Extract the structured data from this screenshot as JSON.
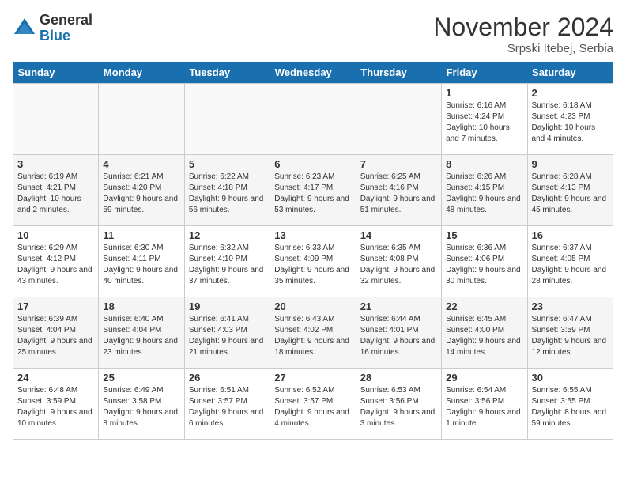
{
  "logo": {
    "general": "General",
    "blue": "Blue"
  },
  "header": {
    "month": "November 2024",
    "location": "Srpski Itebej, Serbia"
  },
  "days_of_week": [
    "Sunday",
    "Monday",
    "Tuesday",
    "Wednesday",
    "Thursday",
    "Friday",
    "Saturday"
  ],
  "weeks": [
    [
      {
        "day": "",
        "empty": true
      },
      {
        "day": "",
        "empty": true
      },
      {
        "day": "",
        "empty": true
      },
      {
        "day": "",
        "empty": true
      },
      {
        "day": "",
        "empty": true
      },
      {
        "day": "1",
        "sunrise": "6:16 AM",
        "sunset": "4:24 PM",
        "daylight": "10 hours and 7 minutes."
      },
      {
        "day": "2",
        "sunrise": "6:18 AM",
        "sunset": "4:23 PM",
        "daylight": "10 hours and 4 minutes."
      }
    ],
    [
      {
        "day": "3",
        "sunrise": "6:19 AM",
        "sunset": "4:21 PM",
        "daylight": "10 hours and 2 minutes."
      },
      {
        "day": "4",
        "sunrise": "6:21 AM",
        "sunset": "4:20 PM",
        "daylight": "9 hours and 59 minutes."
      },
      {
        "day": "5",
        "sunrise": "6:22 AM",
        "sunset": "4:18 PM",
        "daylight": "9 hours and 56 minutes."
      },
      {
        "day": "6",
        "sunrise": "6:23 AM",
        "sunset": "4:17 PM",
        "daylight": "9 hours and 53 minutes."
      },
      {
        "day": "7",
        "sunrise": "6:25 AM",
        "sunset": "4:16 PM",
        "daylight": "9 hours and 51 minutes."
      },
      {
        "day": "8",
        "sunrise": "6:26 AM",
        "sunset": "4:15 PM",
        "daylight": "9 hours and 48 minutes."
      },
      {
        "day": "9",
        "sunrise": "6:28 AM",
        "sunset": "4:13 PM",
        "daylight": "9 hours and 45 minutes."
      }
    ],
    [
      {
        "day": "10",
        "sunrise": "6:29 AM",
        "sunset": "4:12 PM",
        "daylight": "9 hours and 43 minutes."
      },
      {
        "day": "11",
        "sunrise": "6:30 AM",
        "sunset": "4:11 PM",
        "daylight": "9 hours and 40 minutes."
      },
      {
        "day": "12",
        "sunrise": "6:32 AM",
        "sunset": "4:10 PM",
        "daylight": "9 hours and 37 minutes."
      },
      {
        "day": "13",
        "sunrise": "6:33 AM",
        "sunset": "4:09 PM",
        "daylight": "9 hours and 35 minutes."
      },
      {
        "day": "14",
        "sunrise": "6:35 AM",
        "sunset": "4:08 PM",
        "daylight": "9 hours and 32 minutes."
      },
      {
        "day": "15",
        "sunrise": "6:36 AM",
        "sunset": "4:06 PM",
        "daylight": "9 hours and 30 minutes."
      },
      {
        "day": "16",
        "sunrise": "6:37 AM",
        "sunset": "4:05 PM",
        "daylight": "9 hours and 28 minutes."
      }
    ],
    [
      {
        "day": "17",
        "sunrise": "6:39 AM",
        "sunset": "4:04 PM",
        "daylight": "9 hours and 25 minutes."
      },
      {
        "day": "18",
        "sunrise": "6:40 AM",
        "sunset": "4:04 PM",
        "daylight": "9 hours and 23 minutes."
      },
      {
        "day": "19",
        "sunrise": "6:41 AM",
        "sunset": "4:03 PM",
        "daylight": "9 hours and 21 minutes."
      },
      {
        "day": "20",
        "sunrise": "6:43 AM",
        "sunset": "4:02 PM",
        "daylight": "9 hours and 18 minutes."
      },
      {
        "day": "21",
        "sunrise": "6:44 AM",
        "sunset": "4:01 PM",
        "daylight": "9 hours and 16 minutes."
      },
      {
        "day": "22",
        "sunrise": "6:45 AM",
        "sunset": "4:00 PM",
        "daylight": "9 hours and 14 minutes."
      },
      {
        "day": "23",
        "sunrise": "6:47 AM",
        "sunset": "3:59 PM",
        "daylight": "9 hours and 12 minutes."
      }
    ],
    [
      {
        "day": "24",
        "sunrise": "6:48 AM",
        "sunset": "3:59 PM",
        "daylight": "9 hours and 10 minutes."
      },
      {
        "day": "25",
        "sunrise": "6:49 AM",
        "sunset": "3:58 PM",
        "daylight": "9 hours and 8 minutes."
      },
      {
        "day": "26",
        "sunrise": "6:51 AM",
        "sunset": "3:57 PM",
        "daylight": "9 hours and 6 minutes."
      },
      {
        "day": "27",
        "sunrise": "6:52 AM",
        "sunset": "3:57 PM",
        "daylight": "9 hours and 4 minutes."
      },
      {
        "day": "28",
        "sunrise": "6:53 AM",
        "sunset": "3:56 PM",
        "daylight": "9 hours and 3 minutes."
      },
      {
        "day": "29",
        "sunrise": "6:54 AM",
        "sunset": "3:56 PM",
        "daylight": "9 hours and 1 minute."
      },
      {
        "day": "30",
        "sunrise": "6:55 AM",
        "sunset": "3:55 PM",
        "daylight": "8 hours and 59 minutes."
      }
    ]
  ]
}
